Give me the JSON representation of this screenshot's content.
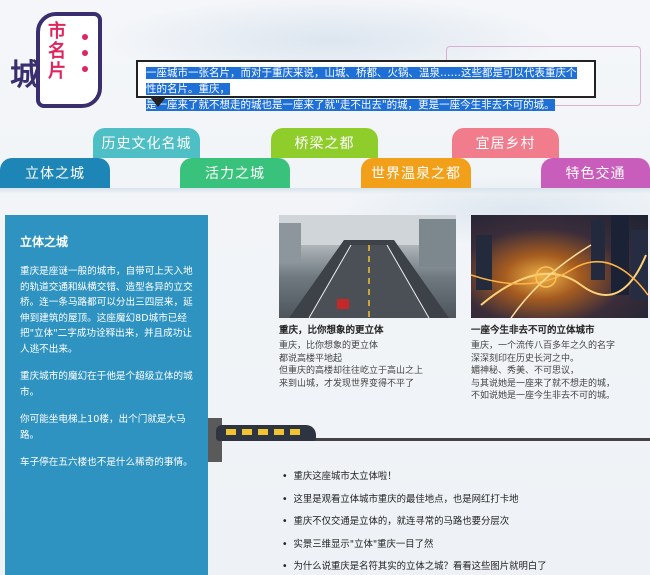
{
  "logo": {
    "big_char": "城",
    "vertical_text": "市名片"
  },
  "intro": {
    "line1": "一座城市一张名片，而对于重庆来说，山城、桥都、火锅、温泉……这些都是可以代表重庆个性的名片。重庆，",
    "line2": "是一座来了就不想走的城也是一座来了就\"走不出去\"的城，更是一座今生非去不可的城。"
  },
  "tabs": [
    {
      "label": "立体之城",
      "color": "#1e86b6"
    },
    {
      "label": "历史文化名城",
      "color": "#4fbfc6"
    },
    {
      "label": "活力之城",
      "color": "#39c27b"
    },
    {
      "label": "桥梁之都",
      "color": "#8fcd2b"
    },
    {
      "label": "世界温泉之都",
      "color": "#f2a019"
    },
    {
      "label": "宜居乡村",
      "color": "#f07c8c"
    },
    {
      "label": "特色交通",
      "color": "#c85dbb"
    }
  ],
  "panel": {
    "title": "立体之城",
    "paragraphs": [
      "重庆是座谜一般的城市，自带可上天入地的轨道交通和纵横交错、造型各异的立交桥。连一条马路都可以分出三四层来，延伸到建筑的屋顶。这座魔幻8D城市已经把\"立体\"二字成功诠释出来，并且成功让人逃不出来。",
      "重庆城市的魔幻在于他是个超级立体的城市。",
      "你可能坐电梯上10楼，出个门就是大马路。",
      "车子停在五六楼也不是什么稀奇的事情。"
    ]
  },
  "photos": [
    {
      "title": "重庆，比你想象的更立体",
      "caption": [
        "重庆，比你想象的更立体",
        "都说高楼平地起",
        "但重庆的高楼却往往屹立于高山之上",
        "来到山城，才发现世界变得不平了"
      ]
    },
    {
      "title": "一座今生非去不可的立体城市",
      "caption": [
        "重庆，一个流传八百多年之久的名字",
        "深深刻印在历史长河之中。",
        "媚神秘、秀美、不可思议，",
        "与其说她是一座来了就不想走的城，",
        "不如说她是一座今生非去不可的城。"
      ]
    }
  ],
  "bullets": [
    "重庆这座城市太立体啦！",
    "这里是观看立体城市重庆的最佳地点，也是网红打卡地",
    "重庆不仅交通是立体的，就连寻常的马路也要分层次",
    "实景三维显示\"立体\"重庆一目了然",
    "为什么说重庆是名符其实的立体之城？看看这些图片就明白了"
  ]
}
